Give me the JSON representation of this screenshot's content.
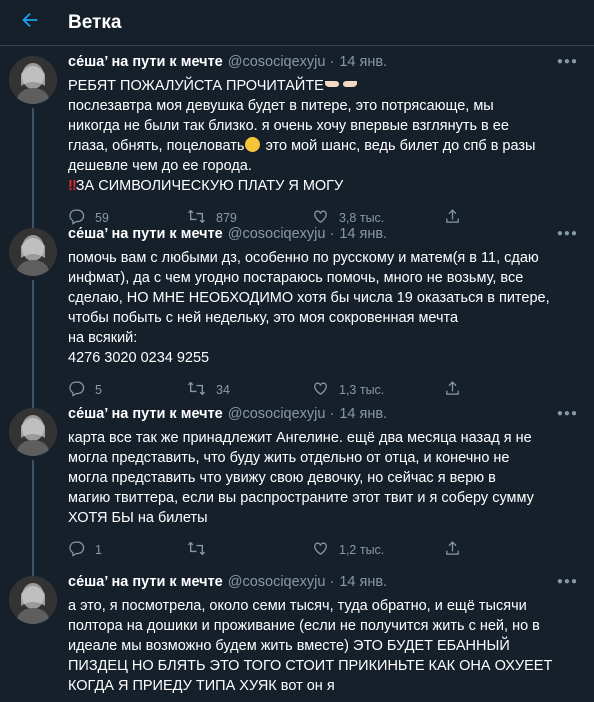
{
  "header": {
    "title": "Ветка"
  },
  "tweets": [
    {
      "name": "се́ша’ на пути к мечте",
      "handle": "@cosociqexyju",
      "separator": "·",
      "date": "14 янв.",
      "lines": [
        "РЕБЯТ ПОЖАЛУЙСТА ПРОЧИТАЙТЕ",
        "послезавтра моя девушка будет в питере, это потрясающе, мы",
        "никогда не были так близко. я очень хочу впервые взглянуть в ее",
        "глаза, обнять, поцеловать",
        "это мой шанс, ведь билет до спб в разы",
        "дешевле чем до ее города.",
        "ЗА СИМВОЛИЧЕСКУЮ ПЛАТУ Я МОГУ"
      ],
      "replies": "59",
      "retweets": "879",
      "likes": "3,8 тыс."
    },
    {
      "name": "се́ша’ на пути к мечте",
      "handle": "@cosociqexyju",
      "separator": "·",
      "date": "14 янв.",
      "lines": [
        "помочь вам с любыми дз, особенно по русскому и матем(я в 11, сдаю",
        "инфмат), да с чем угодно постараюсь помочь, много не возьму, все",
        "сделаю, НО МНЕ НЕОБХОДИМО хотя бы числа 19 оказаться в питере,",
        "чтобы побыть с ней недельку, это моя сокровенная мечта",
        "на всякий:",
        "4276 3020 0234 9255"
      ],
      "replies": "5",
      "retweets": "34",
      "likes": "1,3 тыс."
    },
    {
      "name": "се́ша’ на пути к мечте",
      "handle": "@cosociqexyju",
      "separator": "·",
      "date": "14 янв.",
      "lines": [
        "карта все так же принадлежит Ангелине. ещё два месяца назад я не",
        "могла представить, что буду жить отдельно от отца, и конечно не",
        "могла представить что увижу свою девочку, но сейчас я верю в",
        "магию твиттера, если вы распространите этот твит и я соберу сумму",
        "ХОТЯ БЫ на билеты"
      ],
      "replies": "1",
      "retweets": "",
      "likes": "1,2 тыс."
    },
    {
      "name": "се́ша’ на пути к мечте",
      "handle": "@cosociqexyju",
      "separator": "·",
      "date": "14 янв.",
      "lines": [
        "а это, я посмотрела, около семи тысяч, туда обратно, и ещё тысячи",
        "полтора на дошики и проживание (если не получится жить с ней, но в",
        "идеале мы возможно будем жить вместе) ЭТО БУДЕТ ЕБАННЫЙ",
        "ПИЗДЕЦ НО БЛЯТЬ ЭТО ТОГО СТОИТ ПРИКИНЬТЕ КАК ОНА ОХУЕЕТ",
        "КОГДА Я ПРИЕДУ ТИПА ХУЯК вот он я"
      ]
    }
  ],
  "colors": {
    "background": "#15202b",
    "border": "#38444d",
    "accent": "#1da1f2",
    "secondary_text": "#8899a6",
    "thread_line": "#3d5466"
  },
  "icons": [
    "back-arrow-icon",
    "more-icon",
    "reply-icon",
    "retweet-icon",
    "like-icon",
    "share-icon",
    "pointing-hands-emoji",
    "smiling-face-emoji",
    "double-exclamation-emoji"
  ]
}
